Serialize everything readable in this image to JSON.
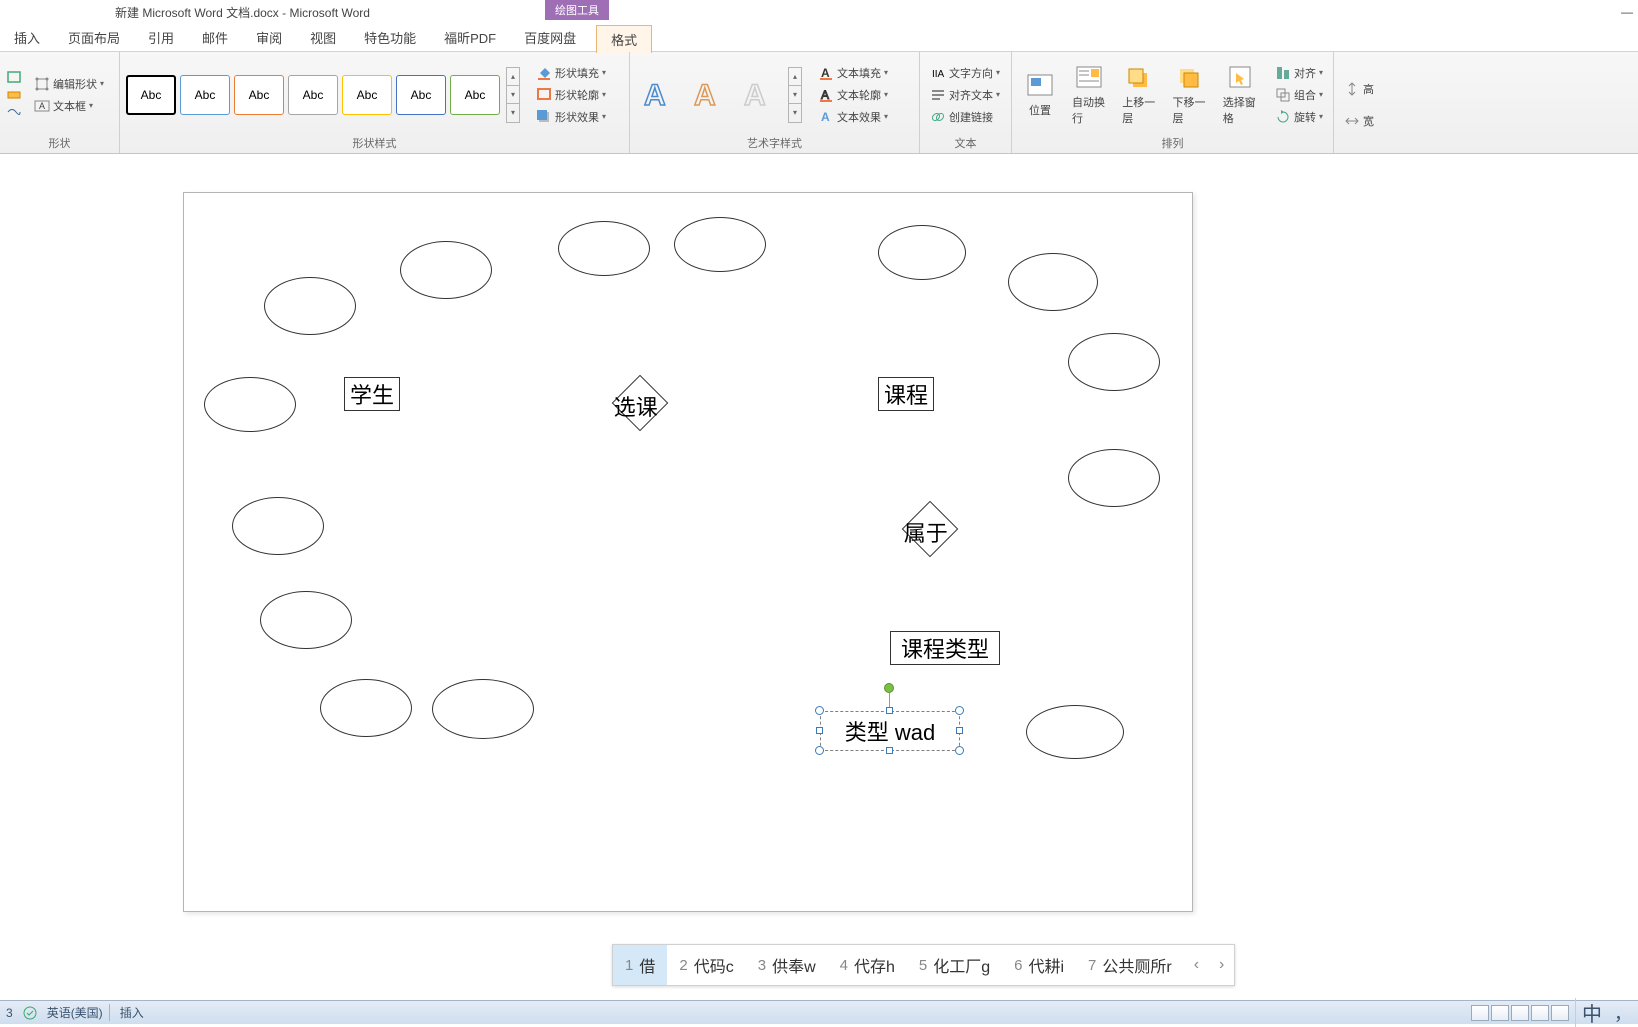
{
  "title": "新建 Microsoft Word 文档.docx - Microsoft Word",
  "contextual_tab": "绘图工具",
  "menu": {
    "insert": "插入",
    "page_layout": "页面布局",
    "references": "引用",
    "mailings": "邮件",
    "review": "审阅",
    "view": "视图",
    "special": "特色功能",
    "foxit": "福昕PDF",
    "baidu": "百度网盘",
    "format": "格式"
  },
  "ribbon": {
    "edit_shape": "编辑形状",
    "text_box": "文本框",
    "shapes_group": "形状",
    "abc": "Abc",
    "shape_styles_group": "形状样式",
    "shape_fill": "形状填充",
    "shape_outline": "形状轮廓",
    "shape_effects": "形状效果",
    "wordart_group": "艺术字样式",
    "text_fill": "文本填充",
    "text_outline": "文本轮廓",
    "text_effects": "文本效果",
    "text_direction": "文字方向",
    "align_text": "对齐文本",
    "create_link": "创建链接",
    "text_group": "文本",
    "position": "位置",
    "wrap_text": "自动换行",
    "bring_forward": "上移一层",
    "send_backward": "下移一层",
    "selection_pane": "选择窗格",
    "align": "对齐",
    "group": "组合",
    "rotate": "旋转",
    "arrange_group": "排列",
    "height": "高",
    "width": "宽"
  },
  "canvas": {
    "student": "学生",
    "course": "课程",
    "select_course": "选课",
    "belongs_to": "属于",
    "course_type": "课程类型",
    "typing_text": "类型 wad"
  },
  "ime": {
    "c1": "借",
    "c2": "代码c",
    "c3": "供奉w",
    "c4": "代存h",
    "c5": "化工厂g",
    "c6": "代耕i",
    "c7": "公共厕所r"
  },
  "status": {
    "lang": "英语(美国)",
    "mode": "插入",
    "ime_lang": "中"
  }
}
